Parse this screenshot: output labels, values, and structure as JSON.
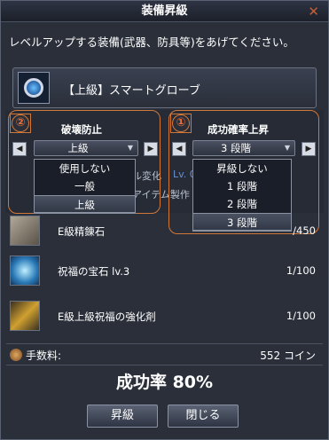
{
  "window": {
    "title": "装備昇級",
    "close_glyph": "✕"
  },
  "instruction": "レベルアップする装備(武器、防具等)をあげてください。",
  "target_item": {
    "name": "【上級】スマートグローブ",
    "icon": "smart-glove-icon"
  },
  "protect": {
    "badge": "②",
    "title": "破壊防止",
    "selected": "上級",
    "options": [
      "使用しない",
      "一般",
      "上級"
    ],
    "selected_index": 2
  },
  "success": {
    "badge": "①",
    "title": "成功確率上昇",
    "selected": "3 段階",
    "options": [
      "昇級しない",
      "1 段階",
      "2 段階",
      "3 段階"
    ],
    "selected_index": 3
  },
  "background_text": {
    "row1": "ル変化",
    "row1b": "Lv. 0",
    "row2": "アイテム製作"
  },
  "materials": [
    {
      "name": "E級精錬石",
      "count": "/450",
      "icon": "refining-stone-icon"
    },
    {
      "name": "祝福の宝石 lv.3",
      "count": "1/100",
      "icon": "blessing-gem-icon"
    },
    {
      "name": "E級上級祝福の強化剤",
      "count": "1/100",
      "icon": "enhancer-icon"
    }
  ],
  "fee": {
    "label": "手数料:",
    "value": "552 コイン",
    "icon": "coin-icon"
  },
  "success_rate": "成功率 80%",
  "buttons": {
    "upgrade": "昇級",
    "close": "閉じる"
  },
  "arrows": {
    "left": "◀",
    "right": "▶"
  },
  "caret": "▼",
  "colors": {
    "highlight": "#d0783a",
    "background": "#2a2f3a"
  }
}
